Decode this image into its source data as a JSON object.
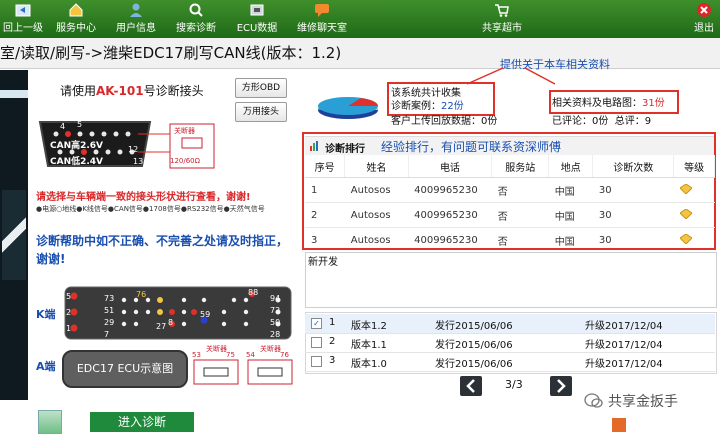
{
  "toolbar": {
    "items": [
      {
        "label": "回上一级",
        "icon": "back-icon"
      },
      {
        "label": "服务中心",
        "icon": "service-center-icon"
      },
      {
        "label": "用户信息",
        "icon": "user-info-icon"
      },
      {
        "label": "搜索诊断",
        "icon": "search-icon"
      },
      {
        "label": "ECU数据",
        "icon": "ecu-icon"
      },
      {
        "label": "维修聊天室",
        "icon": "chat-icon"
      },
      {
        "label": "共享超市",
        "icon": "cart-icon"
      },
      {
        "label": "退出",
        "icon": "close-icon"
      }
    ]
  },
  "breadcrumb": "室/读取/刷写->潍柴EDC17刷写CAN线(版本：1.2)",
  "left": {
    "instruction_prefix": "请使用",
    "instruction_highlight": "AK-101",
    "instruction_suffix": "号诊断接头",
    "btn_square_obd": "方形OBD",
    "btn_universal": "万用接头",
    "can_high": "CAN高2.6V",
    "can_low": "CAN低2.4V",
    "pin4": "4",
    "pin5": "5",
    "pin12": "12",
    "pin13": "13",
    "term_label": "关断器",
    "resistor": "120/60Ω",
    "select_note": "请选择与车辆端一致的接头形状进行查看，谢谢!",
    "legend": "●电源○地线●K线信号●CAN信号●1708信号●RS232信号●天然气信号",
    "help_note": "诊断帮助中如不正确、不完善之处请及时指正，谢谢!",
    "kend": "K端",
    "aend": "A端",
    "kpins": [
      "5",
      "2",
      "1",
      "73",
      "51",
      "29",
      "7",
      "76",
      "27",
      "8",
      "88",
      "94",
      "72",
      "50",
      "28"
    ],
    "pin59": "59",
    "ecu_label": "EDC17 ECU示意图",
    "a_nums": [
      "53",
      "75",
      "54",
      "76"
    ],
    "a_term": "关断器",
    "enter_diag": "进入诊断"
  },
  "right": {
    "stats_label1": "该系统共计收集",
    "stats_label2": "诊断案例：",
    "stats_cases": "22份",
    "stats_label3": "客户上传回放数据：",
    "stats_uploads": "0份",
    "related_label": "相关资料及电路图：",
    "related_count": "31份",
    "reviews_label": "已评论：",
    "reviews_count": "0份",
    "total_label": "总评：",
    "total_count": "9",
    "note_red": "提供关于本车相关资料",
    "rank_title": "诊断排行",
    "rank_note": "经验排行，有问题可联系资深师傅",
    "rank_headers": [
      "序号",
      "姓名",
      "电话",
      "服务站",
      "地点",
      "诊断次数",
      "等级"
    ],
    "rank_rows": [
      [
        "1",
        "Autosos",
        "4009965230",
        "否",
        "中国",
        "30"
      ],
      [
        "2",
        "Autosos",
        "4009965230",
        "否",
        "中国",
        "30"
      ],
      [
        "3",
        "Autosos",
        "4009965230",
        "否",
        "中国",
        "30"
      ]
    ],
    "new_dev": "新开发",
    "versions": [
      {
        "idx": "1",
        "name": "版本1.2",
        "release": "发行2015/06/06",
        "upgrade": "升级2017/12/04",
        "checked": true
      },
      {
        "idx": "2",
        "name": "版本1.1",
        "release": "发行2015/06/06",
        "upgrade": "升级2017/12/04",
        "checked": false
      },
      {
        "idx": "3",
        "name": "版本1.0",
        "release": "发行2015/06/06",
        "upgrade": "升级2017/12/04",
        "checked": false
      }
    ],
    "page_indicator": "3/3",
    "watermark": "共享金扳手"
  }
}
